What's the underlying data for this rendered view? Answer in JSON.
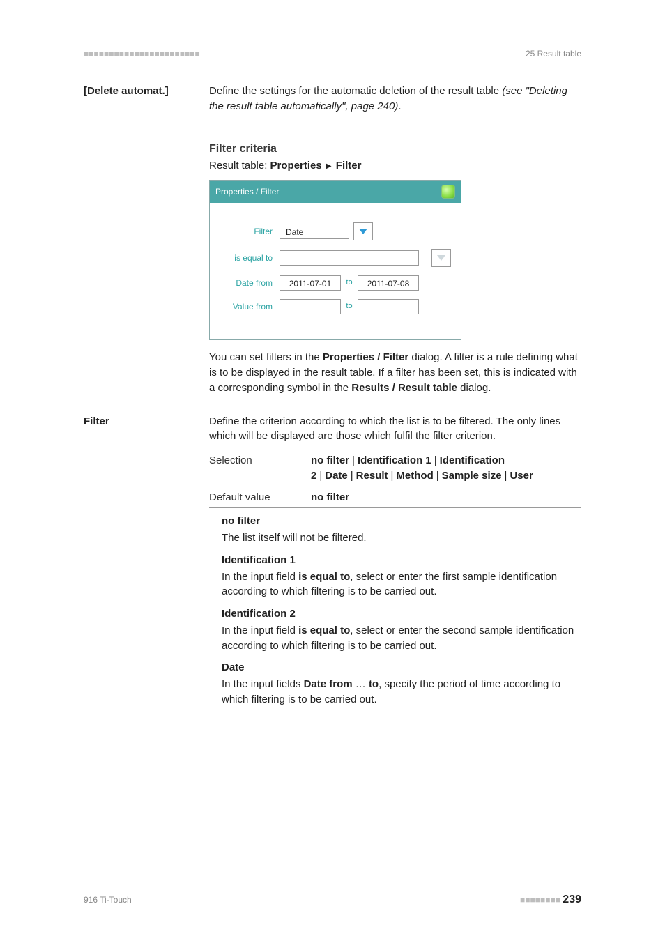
{
  "header": {
    "decor": "■■■■■■■■■■■■■■■■■■■■■■■",
    "section": "25 Result table"
  },
  "sec1": {
    "label": "[Delete automat.]",
    "para_a": "Define the settings for the automatic deletion of the result table ",
    "para_b": "(see \"Deleting the result table automatically\", page 240)",
    "para_c": "."
  },
  "filter_criteria": {
    "heading": "Filter criteria",
    "path_a": "Result table: ",
    "path_b": "Properties",
    "path_c": "Filter"
  },
  "dialog": {
    "title": "Properties / Filter",
    "labels": {
      "filter": "Filter",
      "is_equal_to": "is equal to",
      "date_from": "Date from",
      "value_from": "Value from",
      "to": "to"
    },
    "values": {
      "filter": "Date",
      "is_equal_to": "",
      "date_from": "2011-07-01",
      "date_to": "2011-07-08",
      "value_from": "",
      "value_to": ""
    }
  },
  "after_dialog": {
    "p1a": "You can set filters in the ",
    "p1b": "Properties / Filter",
    "p1c": " dialog. A filter is a rule defining what is to be displayed in the result table. If a filter has been set, this is indicated with a corresponding symbol in the ",
    "p1d": "Results / Result table",
    "p1e": " dialog."
  },
  "filter_section": {
    "label": "Filter",
    "intro": "Define the criterion according to which the list is to be filtered. The only lines which will be displayed are those which fulfil the filter criterion.",
    "selection_label": "Selection",
    "selection_opts": [
      "no filter",
      "Identification 1",
      "Identification 2",
      "Date",
      "Result",
      "Method",
      "Sample size",
      "User"
    ],
    "default_label": "Default value",
    "default_value": "no filter",
    "defs": {
      "nofilter": {
        "t": "no filter",
        "d": "The list itself will not be filtered."
      },
      "id1": {
        "t": "Identification 1",
        "d_a": "In the input field ",
        "d_b": "is equal to",
        "d_c": ", select or enter the first sample identification according to which filtering is to be carried out."
      },
      "id2": {
        "t": "Identification 2",
        "d_a": "In the input field ",
        "d_b": "is equal to",
        "d_c": ", select or enter the second sample identification according to which filtering is to be carried out."
      },
      "date": {
        "t": "Date",
        "d_a": "In the input fields ",
        "d_b": "Date from",
        "d_mid": " … ",
        "d_c": "to",
        "d_d": ", specify the period of time according to which filtering is to be carried out."
      }
    }
  },
  "footer": {
    "product": "916 Ti-Touch",
    "decor": "■■■■■■■■",
    "page": "239"
  }
}
